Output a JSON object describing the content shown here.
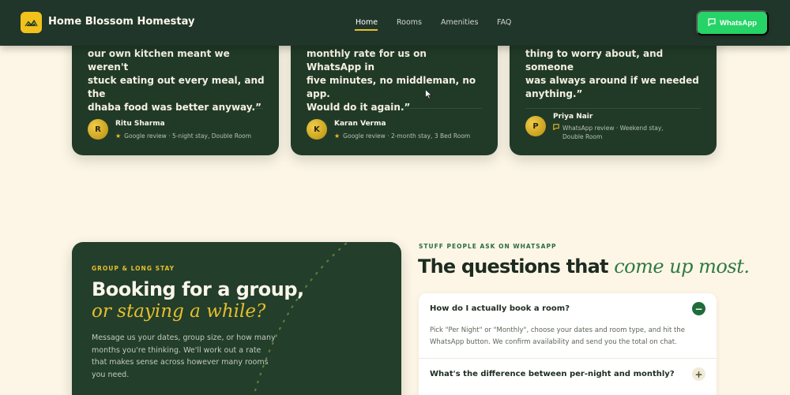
{
  "brand": {
    "name": "Home Blossom Homestay"
  },
  "nav": {
    "links": [
      {
        "label": "Home",
        "active": true
      },
      {
        "label": "Rooms",
        "active": false
      },
      {
        "label": "Amenities",
        "active": false
      },
      {
        "label": "FAQ",
        "active": false
      }
    ],
    "whatsapp_label": "WhatsApp"
  },
  "testimonials": [
    {
      "quote_lines": [
        "our own kitchen meant we weren't",
        "stuck eating out every meal, and the",
        "dhaba food was better anyway.”"
      ],
      "initial": "R",
      "author": "Ritu Sharma",
      "meta_icon": "star-icon",
      "meta": "Google review · 5-night stay, Double Room"
    },
    {
      "quote_lines": [
        "monthly rate for us on WhatsApp in",
        "five minutes, no middleman, no app.",
        "Would do it again.”"
      ],
      "initial": "K",
      "author": "Karan Verma",
      "meta_icon": "star-icon",
      "meta": "Google review · 2-month stay, 3 Bed Room"
    },
    {
      "quote_lines": [
        "thing to worry about, and someone",
        "was always around if we needed",
        "anything.”"
      ],
      "initial": "P",
      "author": "Priya Nair",
      "meta_icon": "chat-icon",
      "meta": "WhatsApp review · Weekend stay, Double Room"
    }
  ],
  "group": {
    "eyebrow": "GROUP & LONG STAY",
    "title": "Booking for a group,",
    "title_em": "or staying a while?",
    "body": "Message us your dates, group size, or how many months you're thinking. We'll work out a rate that makes sense across however many rooms you need."
  },
  "faq": {
    "eyebrow": "STUFF PEOPLE ASK ON WHATSAPP",
    "title": "The questions that",
    "title_em": "come up most.",
    "items": [
      {
        "question": "How do I actually book a room?",
        "answer": "Pick \"Per Night\" or \"Monthly\", choose your dates and room type, and hit the WhatsApp button. We confirm availability and send you the total on chat.",
        "toggle": "−"
      },
      {
        "question": "What's the difference between per-night and monthly?",
        "toggle": "+"
      }
    ]
  },
  "colors": {
    "page_bg": "#fdf6e6",
    "card_green": "#213a28",
    "accent_gold": "#e6bf2d",
    "whatsapp_green": "#25d366",
    "faq_green": "#2f7a42"
  }
}
